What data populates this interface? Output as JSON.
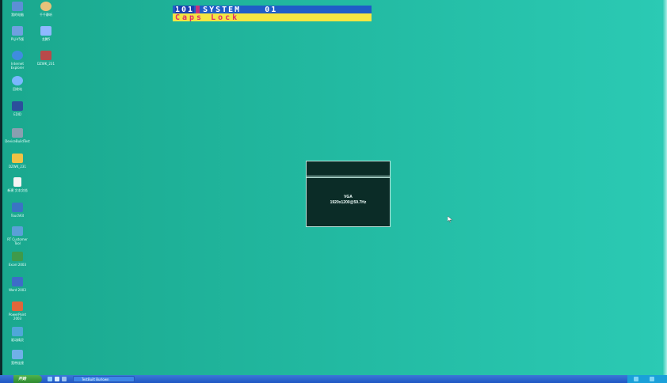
{
  "desktop_icons": [
    {
      "label": "我的电脑",
      "icon": "computer-icon",
      "color": "#5c8fd6"
    },
    {
      "label": "千千静听",
      "icon": "player-icon",
      "color": "#e8c27a"
    },
    {
      "label": "PLJ-V5版",
      "icon": "app-icon",
      "color": "#6fa0e0"
    },
    {
      "label": "龙腾5",
      "icon": "feather-icon",
      "color": "#8fb8ff"
    },
    {
      "label": "Internet Explorer",
      "icon": "ie-icon",
      "color": "#3f8ce0"
    },
    {
      "label": "DZWK_231",
      "icon": "film-icon",
      "color": "#b84a4a"
    },
    {
      "label": "回收站",
      "icon": "recycle-bin-icon",
      "color": "#7ab7ff"
    },
    {
      "label": "EDID",
      "icon": "monitor-icon",
      "color": "#2b4f9c"
    },
    {
      "label": "DeviceBuildTest",
      "icon": "device-icon",
      "color": "#8a9fb0"
    },
    {
      "label": "DZWK_231",
      "icon": "folder-icon",
      "color": "#f0c244"
    },
    {
      "label": "新建 文本文档",
      "icon": "text-file-icon",
      "color": "#f4f4f4"
    },
    {
      "label": "TouchKit",
      "icon": "touchkit-icon",
      "color": "#3a74c4"
    },
    {
      "label": "RT Customer Tool",
      "icon": "tool-icon",
      "color": "#5aa0d8"
    },
    {
      "label": "Excel 2003",
      "icon": "excel-icon",
      "color": "#3f9a4a"
    },
    {
      "label": "Word 2003",
      "icon": "word-icon",
      "color": "#3d6cc8"
    },
    {
      "label": "PowerPoint 2003",
      "icon": "powerpoint-icon",
      "color": "#e0663a"
    },
    {
      "label": "驱动精灵",
      "icon": "driver-icon",
      "color": "#4fa7d8"
    },
    {
      "label": "宽带连接",
      "icon": "network-icon",
      "color": "#6fb0e8"
    }
  ],
  "osd": {
    "port": "101",
    "name": "SYSTEM",
    "channel": "01",
    "caps": "Caps Lock"
  },
  "dialog": {
    "signal": "VGA",
    "resolution": "1920x1200@59.7Hz"
  },
  "taskbar": {
    "start_label": "开始",
    "task_label": "TestBuilt Burlown",
    "accent": "#1f56c4"
  }
}
